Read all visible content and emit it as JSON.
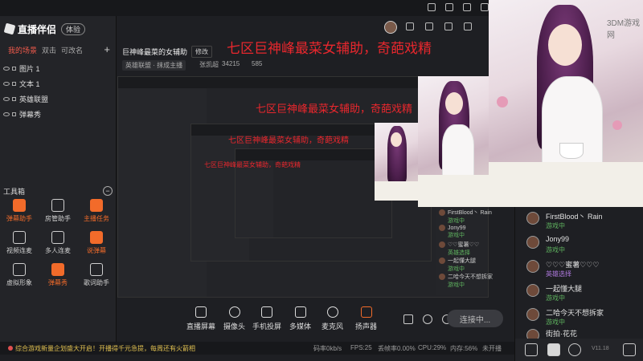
{
  "app": {
    "name": "直播伴侣",
    "version_badge": "体验"
  },
  "scenes": {
    "tabs": [
      "我的场景",
      "双击",
      "可改名"
    ],
    "add_label": "+"
  },
  "sources": [
    {
      "label": "图片 1"
    },
    {
      "label": "文本 1"
    },
    {
      "label": "英雄联盟"
    },
    {
      "label": "弹幕秀"
    }
  ],
  "toolbox": {
    "title": "工具箱",
    "collapse": "−",
    "tools": [
      {
        "label": "弹幕助手",
        "highlight": true
      },
      {
        "label": "房管助手",
        "highlight": false
      },
      {
        "label": "主播任务",
        "highlight": true
      },
      {
        "label": "视频连麦",
        "highlight": false
      },
      {
        "label": "多人连麦",
        "highlight": false
      },
      {
        "label": "说弹幕",
        "highlight": true
      },
      {
        "label": "虚拟形象",
        "highlight": false
      },
      {
        "label": "弹幕秀",
        "highlight": true
      },
      {
        "label": "歌词助手",
        "highlight": false
      }
    ]
  },
  "room": {
    "title": "巨神峰最菜的女辅助",
    "edit_label": "修改",
    "category": "英雄联盟 · 抹成主播",
    "host": "张凯超",
    "id": "34215",
    "fans": "585"
  },
  "overlay_text": "七区巨神峰最菜女辅助，奇葩戏精",
  "overlay_text_nested": "七区巨神峰最菜女辅助，奇葩戏精",
  "controls": {
    "items": [
      "直播屏幕",
      "摄像头",
      "手机投屏",
      "多媒体",
      "麦克风",
      "扬声器"
    ],
    "start_label": "连接中..."
  },
  "status": {
    "notice": "综合游戏新量企划盛大开启！开播得千元急提，每周还有火箭相",
    "net": "码率0kb/s",
    "fps": "FPS:25",
    "drop": "丢帧率0.00%",
    "cpu": "CPU:29%",
    "mem": "内存:56%",
    "state": "未开播"
  },
  "chat": {
    "rows": [
      {
        "name": "FirstBlood丶 Rain",
        "status": "游戏中",
        "color": "green"
      },
      {
        "name": "Jony99",
        "status": "游戏中",
        "color": "green"
      },
      {
        "name": "♡♡♡蜜薯♡♡♡",
        "status": "英雄选择",
        "color": "purple"
      },
      {
        "name": "一起懂大腿",
        "status": "游戏中",
        "color": "green"
      },
      {
        "name": "二哈今天不想拆家",
        "status": "游戏中",
        "color": "green"
      },
      {
        "name": "街拍·花花",
        "status": "",
        "color": "green"
      }
    ],
    "version": "V11.18"
  },
  "inner_chat": [
    {
      "name": "FirstBlood丶 Rain",
      "status": "游戏中"
    },
    {
      "name": "Jony99",
      "status": "游戏中"
    },
    {
      "name": "♡♡蜜薯♡♡",
      "status": "英雄选择"
    },
    {
      "name": "一起懂大腿",
      "status": "游戏中"
    },
    {
      "name": "二哈今天不想拆家",
      "status": "游戏中"
    }
  ],
  "watermark": "3DM游戏网"
}
